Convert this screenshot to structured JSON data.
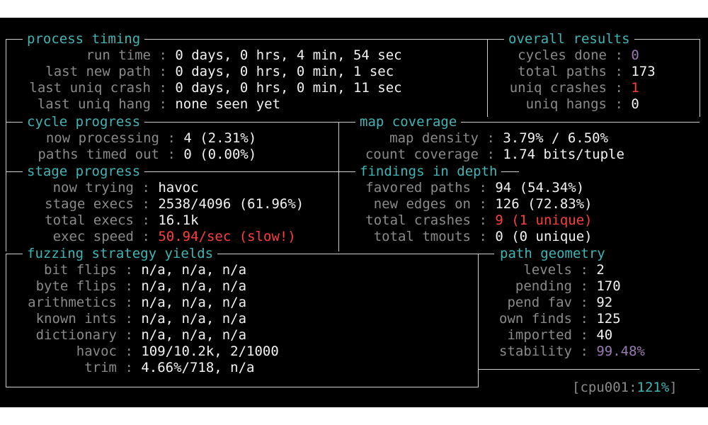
{
  "colors": {
    "title": "#3fb5b5",
    "label": "#8a8a8a",
    "value": "#f2f2f2",
    "alert": "#ff3d3d",
    "muted": "#9a7ab0"
  },
  "process_timing": {
    "title": "process timing",
    "rows": [
      {
        "label": "run time",
        "value": "0 days, 0 hrs, 4 min, 54 sec"
      },
      {
        "label": "last new path",
        "value": "0 days, 0 hrs, 0 min, 1 sec"
      },
      {
        "label": "last uniq crash",
        "value": "0 days, 0 hrs, 0 min, 11 sec"
      },
      {
        "label": "last uniq hang",
        "value": "none seen yet"
      }
    ]
  },
  "overall_results": {
    "title": "overall results",
    "rows": [
      {
        "label": "cycles done",
        "value": "0"
      },
      {
        "label": "total paths",
        "value": "173"
      },
      {
        "label": "uniq crashes",
        "value": "1"
      },
      {
        "label": "uniq hangs",
        "value": "0"
      }
    ]
  },
  "cycle_progress": {
    "title": "cycle progress",
    "rows": [
      {
        "label": "now processing",
        "value": "4 (2.31%)"
      },
      {
        "label": "paths timed out",
        "value": "0 (0.00%)"
      }
    ]
  },
  "map_coverage": {
    "title": "map coverage",
    "rows": [
      {
        "label": "map density",
        "value": "3.79% / 6.50%"
      },
      {
        "label": "count coverage",
        "value": "1.74 bits/tuple"
      }
    ]
  },
  "stage_progress": {
    "title": "stage progress",
    "rows": [
      {
        "label": "now trying",
        "value": "havoc"
      },
      {
        "label": "stage execs",
        "value": "2538/4096 (61.96%)"
      },
      {
        "label": "total execs",
        "value": "16.1k"
      },
      {
        "label": "exec speed",
        "value": "50.94/sec (slow!)"
      }
    ]
  },
  "findings_in_depth": {
    "title": "findings in depth",
    "rows": [
      {
        "label": "favored paths",
        "value": "94 (54.34%)"
      },
      {
        "label": "new edges on",
        "value": "126 (72.83%)"
      },
      {
        "label": "total crashes",
        "value": "9 (1 unique)"
      },
      {
        "label": "total tmouts",
        "value": "0 (0 unique)"
      }
    ]
  },
  "fuzzing_strategy_yields": {
    "title": "fuzzing strategy yields",
    "rows": [
      {
        "label": "bit flips",
        "value": "n/a, n/a, n/a"
      },
      {
        "label": "byte flips",
        "value": "n/a, n/a, n/a"
      },
      {
        "label": "arithmetics",
        "value": "n/a, n/a, n/a"
      },
      {
        "label": "known ints",
        "value": "n/a, n/a, n/a"
      },
      {
        "label": "dictionary",
        "value": "n/a, n/a, n/a"
      },
      {
        "label": "havoc",
        "value": "109/10.2k, 2/1000"
      },
      {
        "label": "trim",
        "value": "4.66%/718, n/a"
      }
    ]
  },
  "path_geometry": {
    "title": "path geometry",
    "rows": [
      {
        "label": "levels",
        "value": "2"
      },
      {
        "label": "pending",
        "value": "170"
      },
      {
        "label": "pend fav",
        "value": "92"
      },
      {
        "label": "own finds",
        "value": "125"
      },
      {
        "label": "imported",
        "value": "40"
      },
      {
        "label": "stability",
        "value": "99.48%"
      }
    ]
  },
  "cpu_status": {
    "open": "[",
    "label": "cpu001:",
    "value": "121%",
    "close": "]"
  }
}
